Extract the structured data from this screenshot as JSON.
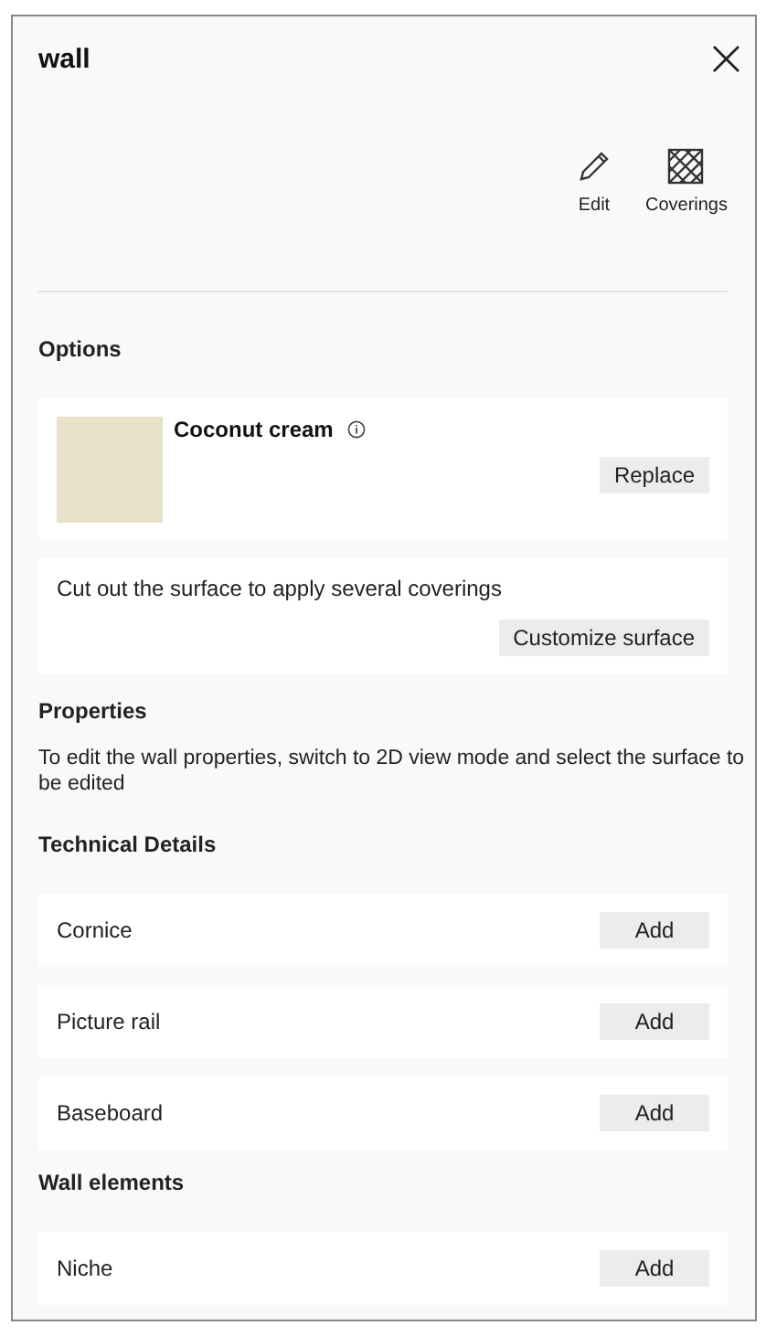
{
  "panel": {
    "title": "wall",
    "close": "×"
  },
  "actions": [
    {
      "kind": "edit",
      "label": "Edit"
    },
    {
      "kind": "coverings",
      "label": "Coverings"
    }
  ],
  "options": {
    "heading": "Options",
    "covering": {
      "name": "Coconut cream",
      "button": "Replace"
    },
    "customize": {
      "text": "Cut out the surface to apply several coverings",
      "button": "Customize surface"
    }
  },
  "properties": {
    "heading": "Properties",
    "text": "To edit the wall properties, switch to 2D view mode and select the surface to be edited"
  },
  "technical_details": {
    "heading": "Technical Details",
    "items": [
      {
        "label": "Cornice",
        "button": "Add"
      },
      {
        "label": "Picture rail",
        "button": "Add"
      },
      {
        "label": "Baseboard",
        "button": "Add"
      }
    ]
  },
  "wall_elements": {
    "heading": "Wall elements",
    "items": [
      {
        "label": "Niche",
        "button": "Add"
      }
    ]
  }
}
